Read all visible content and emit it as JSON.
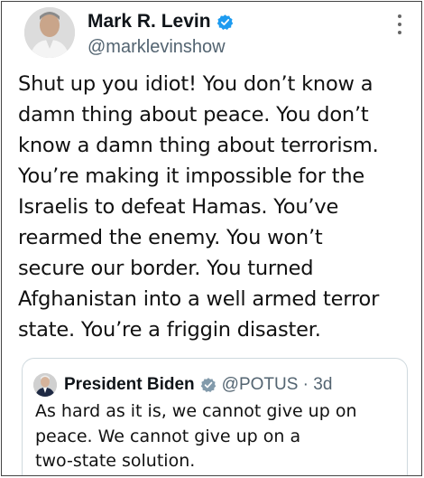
{
  "tweet": {
    "author": {
      "display_name": "Mark R. Levin",
      "handle": "@marklevinshow",
      "avatar_icon": "person-avatar-icon",
      "verified_color": "#1d9bf0"
    },
    "text_lines": [
      "Shut up you idiot!  You don’t know a",
      "damn thing about peace. You don’t",
      "know a damn thing about terrorism.",
      "You’re making it impossible for the",
      "Israelis to defeat Hamas. You’ve",
      "rearmed the enemy. You won’t",
      "secure our border. You turned",
      "Afghanistan into a well armed terror",
      "state. You’re a friggin disaster."
    ]
  },
  "quote": {
    "display_name": "President Biden",
    "handle_time": "@POTUS · 3d",
    "badge_color": "#829aab",
    "text_lines": [
      "As hard as it is, we cannot give up on",
      "peace.  We cannot give up on a",
      "two-state solution."
    ]
  }
}
